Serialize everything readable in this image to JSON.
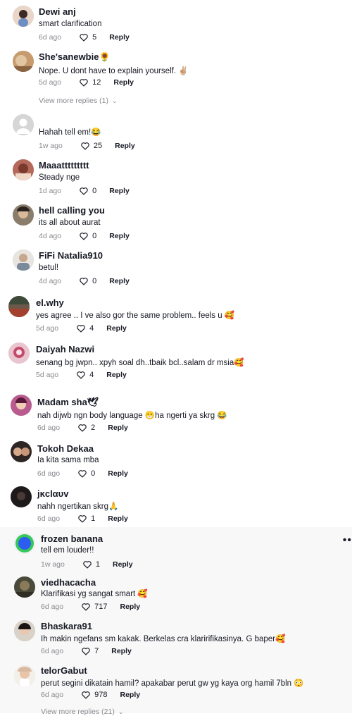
{
  "comments": [
    {
      "username": "Dewi anj",
      "text": "smart clarification",
      "time": "6d ago",
      "likes": "5",
      "reply": "Reply"
    },
    {
      "username": "She'sanewbie🌻",
      "text": "Nope. U dont have to explain yourself. ✌🏼",
      "time": "5d ago",
      "likes": "12",
      "reply": "Reply",
      "view_more": "View more replies (1)"
    },
    {
      "username": "",
      "text": "Hahah tell em!😂",
      "time": "1w ago",
      "likes": "25",
      "reply": "Reply"
    },
    {
      "username": "Maaattttttttt",
      "text": "Steady nge",
      "time": "1d ago",
      "likes": "0",
      "reply": "Reply"
    },
    {
      "username": "hell calling you",
      "text": "its all about aurat",
      "time": "4d ago",
      "likes": "0",
      "reply": "Reply"
    },
    {
      "username": "FiFi Natalia910",
      "text": "betul!",
      "time": "4d ago",
      "likes": "0",
      "reply": "Reply"
    },
    {
      "username": "el.why",
      "text": "yes agree .. I ve also gor the same problem.. feels u 🥰",
      "time": "5d ago",
      "likes": "4",
      "reply": "Reply"
    },
    {
      "username": "Daiyah Nazwi",
      "text": "senang bg jwpn.. xpyh soal dh..tbaik bcl..salam dr msia🥰",
      "time": "5d ago",
      "likes": "4",
      "reply": "Reply"
    },
    {
      "username": "Madam sha🕊",
      "text": "nah dijwb ngn body language 😁ha ngerti ya skrg 😂",
      "time": "6d ago",
      "likes": "2",
      "reply": "Reply"
    },
    {
      "username": "Tokoh Dekaa",
      "text": "Ia kita sama mba",
      "time": "6d ago",
      "likes": "0",
      "reply": "Reply"
    },
    {
      "username": "jĸclαυv",
      "text": "nahh ngertikan skrg🙏",
      "time": "6d ago",
      "likes": "1",
      "reply": "Reply"
    },
    {
      "username": "frozen banana",
      "text": "tell em louder!!",
      "time": "1w ago",
      "likes": "1",
      "reply": "Reply"
    },
    {
      "username": "viedhacacha",
      "text": "Klarifikasi yg sangat smart 🥰",
      "time": "6d ago",
      "likes": "717",
      "reply": "Reply"
    },
    {
      "username": "Bhaskara91",
      "text": "Ih makin ngefans sm kakak. Berkelas cra klaririfikasinya. G baper🥰",
      "time": "6d ago",
      "likes": "7",
      "reply": "Reply"
    },
    {
      "username": "telorGabut",
      "text": "perut segini dikatain hamil? apakabar perut gw yg kaya org hamil 7bln 😳",
      "time": "6d ago",
      "likes": "978",
      "reply": "Reply",
      "view_more": "View more replies (21)"
    }
  ],
  "colors": {
    "text": "#161823",
    "muted": "#8a8b91",
    "highlight_bg": "#f8f8f8"
  },
  "icons": {
    "like": "heart-outline-icon",
    "more": "more-dots-icon",
    "expand": "chevron-down-icon"
  }
}
